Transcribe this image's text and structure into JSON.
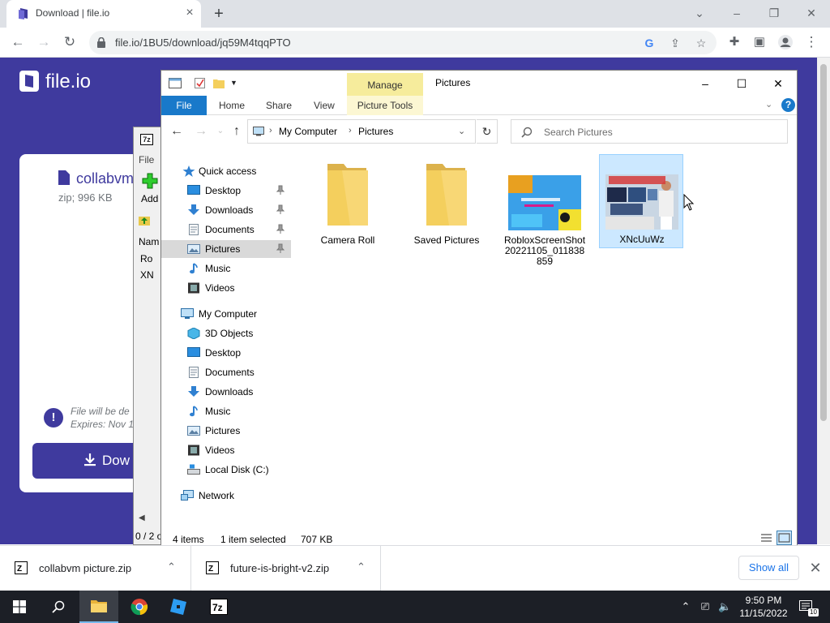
{
  "browser": {
    "tab_title": "Download | file.io",
    "url": "file.io/1BU5/download/jq59M4tqqPTO"
  },
  "fileio": {
    "brand": "file.io",
    "file_name": "collabvm",
    "file_meta": "zip; 996 KB",
    "notice_line1": "File will be de",
    "notice_line2": "Expires: Nov 1",
    "download_label": "Dow"
  },
  "sevenzip": {
    "logo": "7z",
    "menu_file": "File",
    "add_label": "Add",
    "col_name": "Nam",
    "rows": [
      "Ro",
      "XN"
    ],
    "status": "0 / 2 o"
  },
  "explorer": {
    "manage_tab": "Manage",
    "title": "Pictures",
    "ribbon_tabs": {
      "file": "File",
      "home": "Home",
      "share": "Share",
      "view": "View",
      "picture_tools": "Picture Tools"
    },
    "breadcrumb": [
      "My Computer",
      "Pictures"
    ],
    "search_placeholder": "Search Pictures",
    "nav": {
      "quick_access": "Quick access",
      "qa_items": [
        "Desktop",
        "Downloads",
        "Documents",
        "Pictures",
        "Music",
        "Videos"
      ],
      "my_computer": "My Computer",
      "pc_items": [
        "3D Objects",
        "Desktop",
        "Documents",
        "Downloads",
        "Music",
        "Pictures",
        "Videos",
        "Local Disk (C:)"
      ],
      "network": "Network"
    },
    "items": [
      {
        "name": "Camera Roll",
        "type": "folder"
      },
      {
        "name": "Saved Pictures",
        "type": "folder"
      },
      {
        "name": "RobloxScreenShot20221105_011838859",
        "type": "image"
      },
      {
        "name": "XNcUuWz",
        "type": "image",
        "selected": true
      }
    ],
    "status": {
      "count": "4 items",
      "selected": "1 item selected",
      "size": "707 KB"
    }
  },
  "downloads": {
    "items": [
      "collabvm picture.zip",
      "future-is-bright-v2.zip"
    ],
    "show_all": "Show all"
  },
  "taskbar": {
    "time": "9:50 PM",
    "date": "11/15/2022",
    "notification_count": "10"
  },
  "colors": {
    "fileio_brand": "#3f3a9e",
    "explorer_file_tab": "#1979ca",
    "manage_tab": "#f6ec9c"
  }
}
